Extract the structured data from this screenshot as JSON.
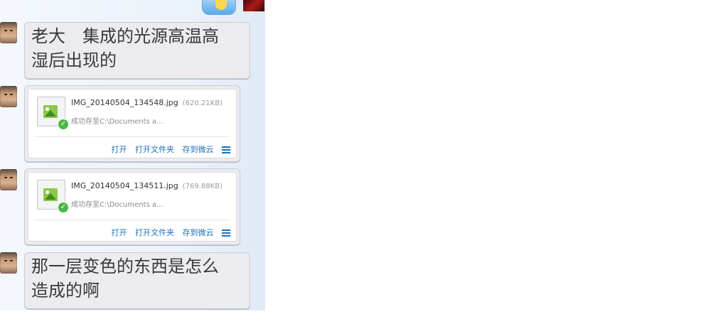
{
  "messages": [
    {
      "type": "text",
      "text": "老大　集成的光源高温高\n湿后出现的"
    },
    {
      "type": "file",
      "name": "IMG_20140504_134548.jpg",
      "size": "(620.21KB)",
      "status": "成功存至C:\\Documents a...",
      "actions": [
        "打开",
        "打开文件夹",
        "存到微云"
      ]
    },
    {
      "type": "file",
      "name": "IMG_20140504_134511.jpg",
      "size": "(769.88KB)",
      "status": "成功存至C:\\Documents a...",
      "actions": [
        "打开",
        "打开文件夹",
        "存到微云"
      ]
    },
    {
      "type": "text",
      "text": "那一层变色的东西是怎么\n造成的啊"
    }
  ],
  "icons": {
    "file": "image-file-icon",
    "ok": "checkmark-icon",
    "menu": "menu-icon"
  },
  "colors": {
    "link": "#1f6fb5",
    "bubble": "#ececf0",
    "panel": "#eaf2fa"
  }
}
